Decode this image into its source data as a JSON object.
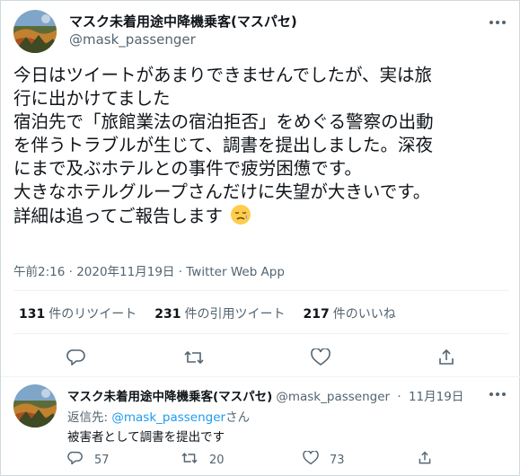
{
  "main_tweet": {
    "display_name": "マスク未着用途中降機乗客(マスパセ)",
    "handle": "@mask_passenger",
    "text_lines": [
      "今日はツイートがあまりできませんでしたが、実は旅",
      "行に出かけてました",
      "宿泊先で「旅館業法の宿泊拒否」をめぐる警察の出動",
      "を伴うトラブルが生じて、調書を提出しました。深夜",
      "にまで及ぶホテルとの事件で疲労困憊です。",
      "大きなホテルグループさんだけに失望が大きいです。",
      "詳細は追ってご報告します"
    ],
    "emoji_icon": "sad-face-icon",
    "timestamp": "午前2:16 · 2020年11月19日",
    "source": "Twitter Web App",
    "stats": [
      {
        "count": "131",
        "label": "件のリツイート"
      },
      {
        "count": "231",
        "label": "件の引用ツイート"
      },
      {
        "count": "217",
        "label": "件のいいね"
      }
    ]
  },
  "reply_tweet": {
    "display_name": "マスク未着用途中降機乗客(マスパセ)",
    "handle": "@mask_passenger",
    "separator": "·",
    "date": "11月19日",
    "reply_prefix": "返信先:",
    "reply_mention": "@mask_passenger",
    "reply_suffix": "さん",
    "text": "被害者として調書を提出です",
    "reply_count": "57",
    "retweet_count": "20",
    "like_count": "73"
  },
  "colors": {
    "text": "#0f1419",
    "secondary": "#536471",
    "link": "#1d9bf0",
    "border": "#eff3f4"
  }
}
